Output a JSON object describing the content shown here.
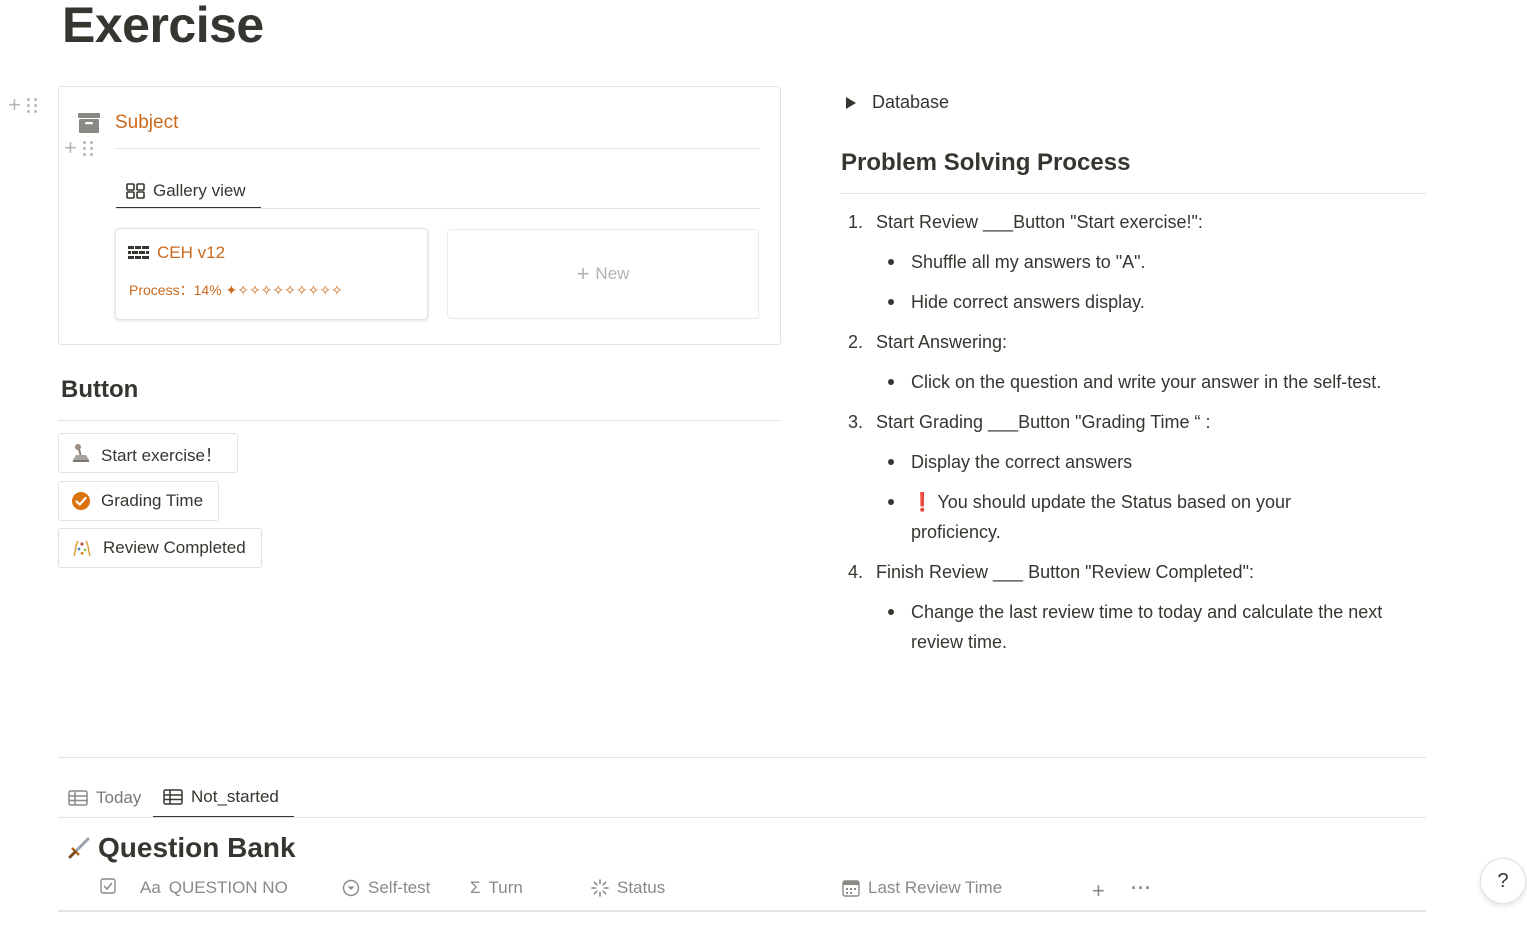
{
  "page": {
    "title": "Exercise"
  },
  "subject": {
    "title": "Subject",
    "view_tab": "Gallery view",
    "cards": [
      {
        "title": "CEH v12",
        "property": "Process：14% ✦✧✧✧✧✧✧✧✧✧",
        "progress_percent": 14
      }
    ],
    "new_label": "New"
  },
  "buttons_section": {
    "heading": "Button",
    "buttons": [
      {
        "label": "Start exercise！",
        "icon": "joystick-icon"
      },
      {
        "label": "Grading Time",
        "icon": "check-circle-icon"
      },
      {
        "label": "Review Completed",
        "icon": "confetti-icon"
      }
    ]
  },
  "right": {
    "toggle_label": "Database",
    "heading": "Problem Solving Process",
    "steps": [
      {
        "num": "1.",
        "text": "Start Review ___Button \"Start exercise!\":",
        "bullets": [
          "Shuffle all my answers to \"A\".",
          "Hide correct answers display."
        ]
      },
      {
        "num": "2.",
        "text": "Start Answering:",
        "bullets": [
          "Click on the question and write your answer in the self-test."
        ]
      },
      {
        "num": "3.",
        "text": "Start Grading ___Button \"Grading Time “ :",
        "bullets": [
          "Display the correct answers",
          "You should update the Status based on your proficiency."
        ]
      },
      {
        "num": "4.",
        "text": "Finish Review ___ Button \"Review Completed\":",
        "bullets": [
          "Change the last review time to today and calculate the next review time."
        ]
      }
    ],
    "warning_mark": "❗"
  },
  "database": {
    "tabs": [
      {
        "label": "Today",
        "active": false
      },
      {
        "label": "Not_started",
        "active": true
      }
    ],
    "title": "Question Bank",
    "columns": [
      {
        "label": "",
        "icon": "checkbox-icon"
      },
      {
        "label": "QUESTION NO",
        "icon_text": "Aa"
      },
      {
        "label": "Self-test",
        "icon": "select-icon"
      },
      {
        "label": "Turn",
        "icon_text": "Σ"
      },
      {
        "label": "Status",
        "icon": "status-icon"
      },
      {
        "label": "Last Review Time",
        "icon": "calendar-icon"
      }
    ]
  },
  "help": {
    "label": "?"
  },
  "colors": {
    "accent": "#cb6a1d",
    "text": "#37352f",
    "muted": "#8a8984",
    "border": "#e3e2df"
  }
}
